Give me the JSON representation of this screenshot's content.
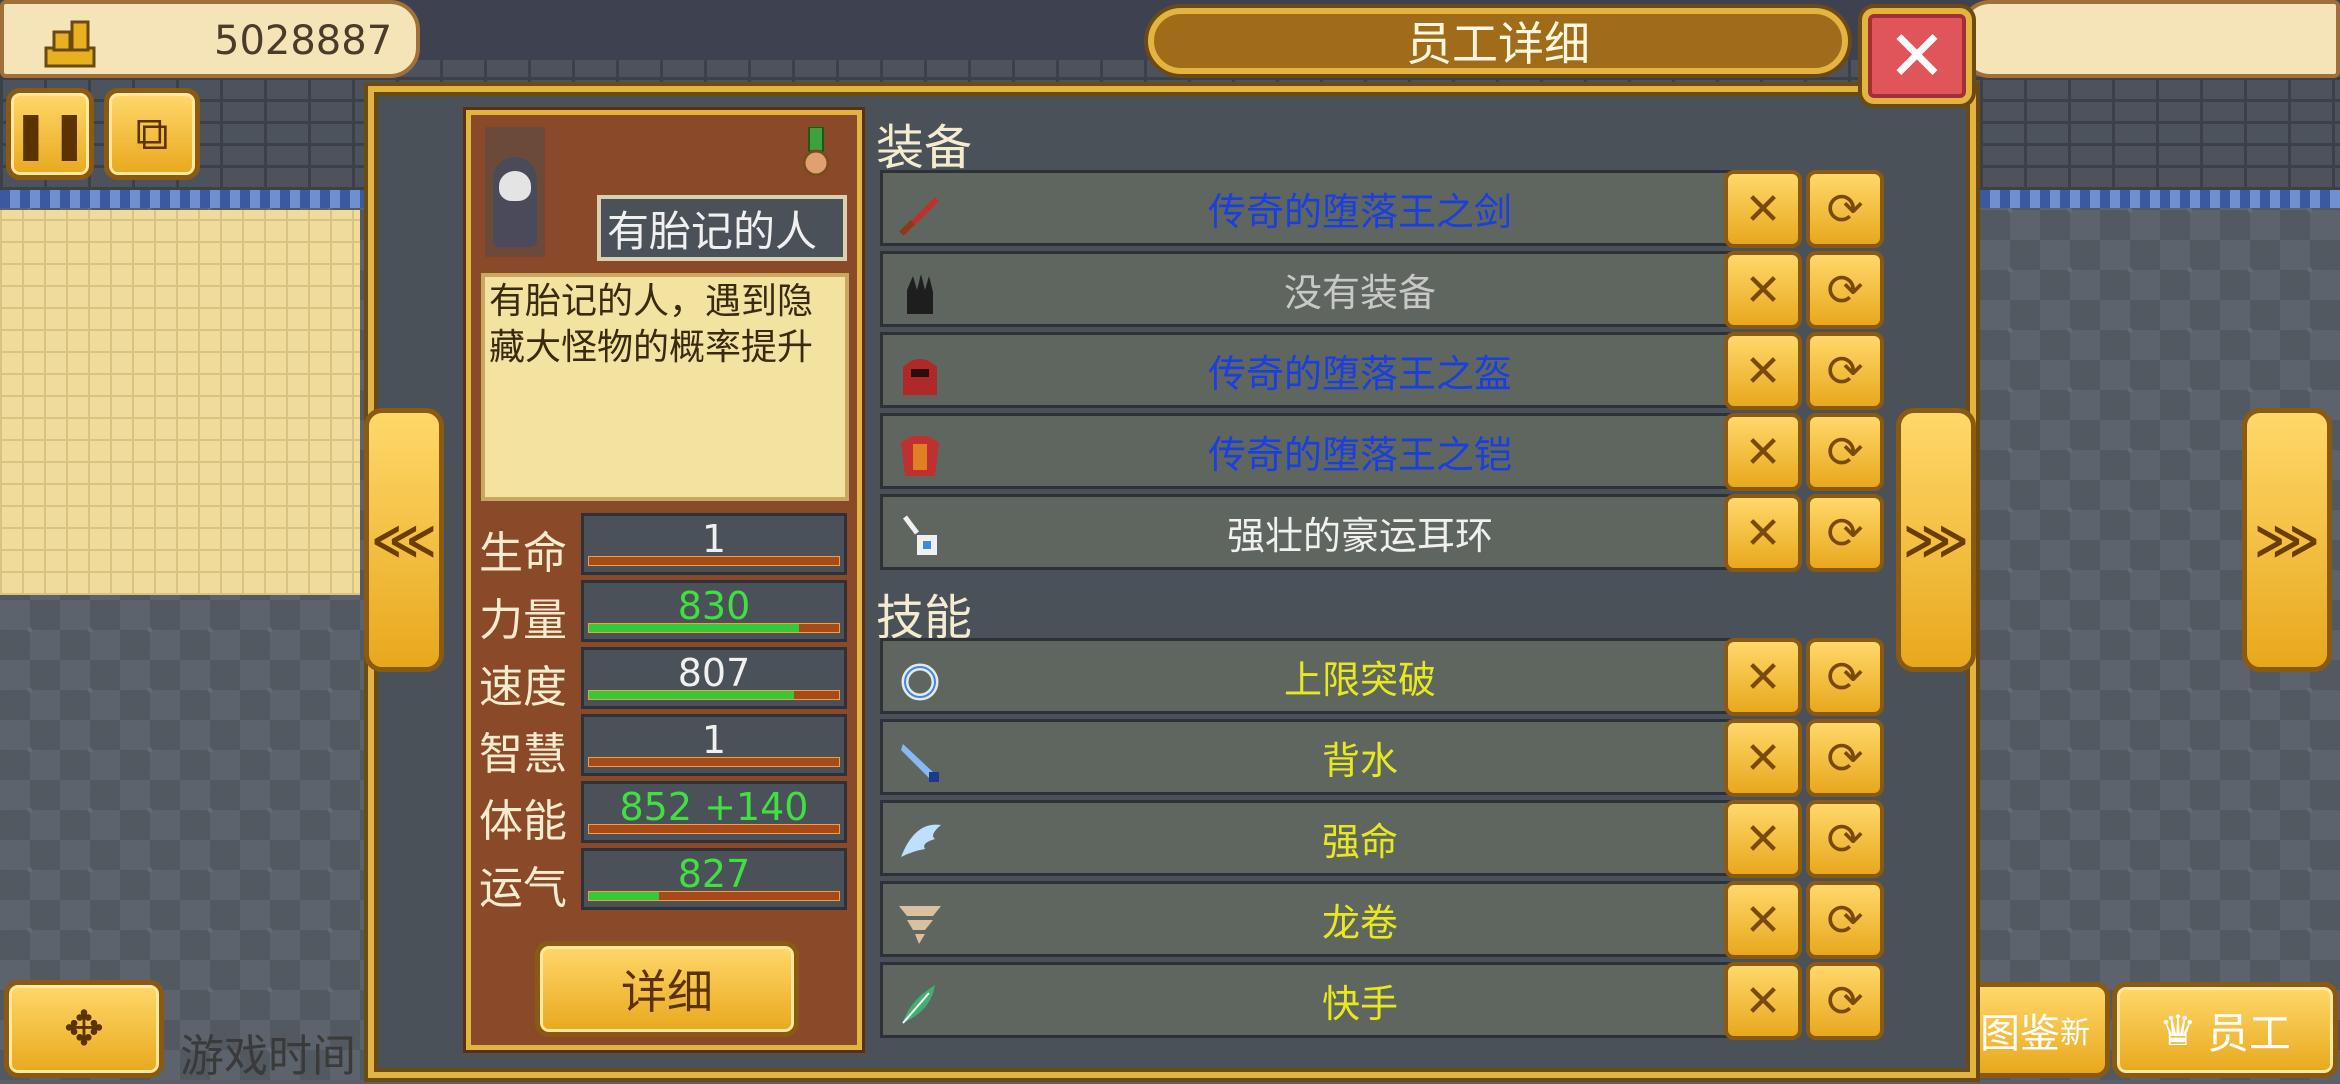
{
  "hud": {
    "coins": "5028887",
    "game_time_label": "游戏时间",
    "employee_tab_label": "员工",
    "illustrated_tab_label": "图鉴",
    "illustrated_tab_badge": "新"
  },
  "dialog": {
    "title": "员工详细",
    "close_glyph": "✕",
    "prev_glyph": "⋘",
    "next_glyph": "⋙"
  },
  "character": {
    "name": "有胎记的人",
    "description": "有胎记的人，遇到隐藏大怪物的概率提升",
    "detail_button": "详细",
    "stats": [
      {
        "label": "生命",
        "value": "1",
        "fill": 0.0,
        "color": "#f0f0f0"
      },
      {
        "label": "力量",
        "value": "830",
        "fill": 0.84,
        "color": "#3fe03f"
      },
      {
        "label": "速度",
        "value": "807",
        "fill": 0.82,
        "color": "#f0f0f0"
      },
      {
        "label": "智慧",
        "value": "1",
        "fill": 0.0,
        "color": "#f0f0f0"
      },
      {
        "label": "体能",
        "value": "852 +140",
        "fill": 0.0,
        "color": "#3fe03f"
      },
      {
        "label": "运气",
        "value": "827",
        "fill": 0.28,
        "color": "#3fe03f"
      }
    ]
  },
  "equipment": {
    "label": "装备",
    "items": [
      {
        "name": "传奇的堕落王之剑",
        "icon": "sword-icon",
        "color": "#1a3fe0"
      },
      {
        "name": "没有装备",
        "icon": "glove-icon",
        "color": "#c8c8c8"
      },
      {
        "name": "传奇的堕落王之盔",
        "icon": "helmet-icon",
        "color": "#1a3fe0"
      },
      {
        "name": "传奇的堕落王之铠",
        "icon": "armor-icon",
        "color": "#1a3fe0"
      },
      {
        "name": "强壮的豪运耳环",
        "icon": "earring-icon",
        "color": "#f0f0f0"
      }
    ]
  },
  "skills": {
    "label": "技能",
    "items": [
      {
        "name": "上限突破",
        "icon": "ring-icon",
        "color": "#e8e820"
      },
      {
        "name": "背水",
        "icon": "blade-icon",
        "color": "#e8e820"
      },
      {
        "name": "强命",
        "icon": "wing-icon",
        "color": "#e8e820"
      },
      {
        "name": "龙卷",
        "icon": "tornado-icon",
        "color": "#e8e820"
      },
      {
        "name": "快手",
        "icon": "feather-icon",
        "color": "#e8e820"
      }
    ]
  }
}
